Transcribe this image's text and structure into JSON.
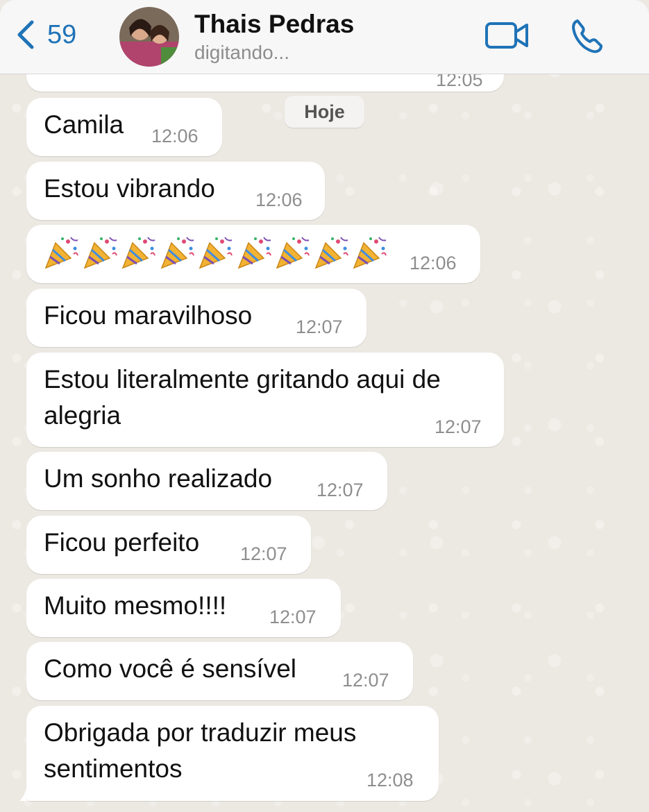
{
  "header": {
    "back_count": "59",
    "contact_name": "Thais Pedras",
    "status": "digitando..."
  },
  "chat": {
    "date_separator": "Hoje",
    "partial_prev_time": "12:05",
    "messages": [
      {
        "text": "Camila",
        "time": "12:06"
      },
      {
        "text": "Estou vibrando",
        "time": "12:06"
      },
      {
        "text": "🎉🎉🎉🎉🎉🎉🎉🎉🎉",
        "emoji": "party-popper",
        "emoji_count": 9,
        "time": "12:06"
      },
      {
        "text": "Ficou maravilhoso",
        "time": "12:07"
      },
      {
        "lines": [
          "Estou literalmente gritando aqui de",
          "alegria"
        ],
        "time": "12:07"
      },
      {
        "text": "Um sonho realizado",
        "time": "12:07"
      },
      {
        "text": "Ficou perfeito",
        "time": "12:07"
      },
      {
        "text": "Muito mesmo!!!!",
        "time": "12:07"
      },
      {
        "text": "Como você é sensível",
        "time": "12:07"
      },
      {
        "lines": [
          "Obrigada por traduzir meus",
          "sentimentos"
        ],
        "time": "12:08"
      }
    ]
  },
  "colors": {
    "accent": "#1f73b7",
    "bubble": "#ffffff",
    "chat_background": "#ece8e2",
    "header_background": "#f7f7f7"
  }
}
